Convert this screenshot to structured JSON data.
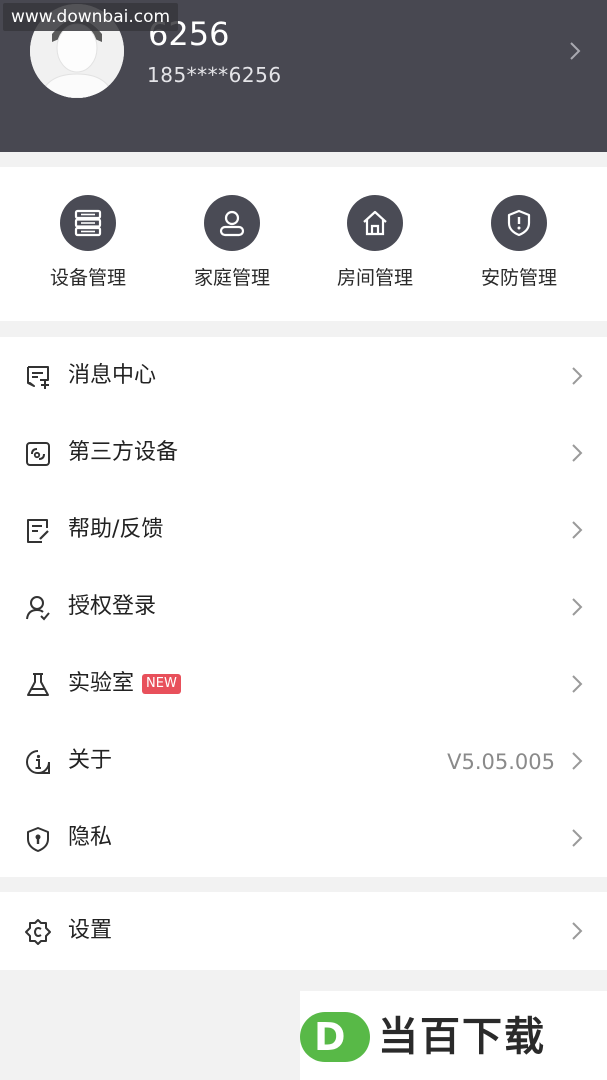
{
  "watermark_top": "www.downbai.com",
  "profile": {
    "name": "6256",
    "phone": "185****6256"
  },
  "quick_actions": [
    {
      "label": "设备管理",
      "icon": "device-list-icon"
    },
    {
      "label": "家庭管理",
      "icon": "user-icon"
    },
    {
      "label": "房间管理",
      "icon": "home-icon"
    },
    {
      "label": "安防管理",
      "icon": "shield-icon"
    }
  ],
  "menu": [
    {
      "label": "消息中心",
      "icon": "message-icon"
    },
    {
      "label": "第三方设备",
      "icon": "third-party-icon"
    },
    {
      "label": "帮助/反馈",
      "icon": "feedback-icon"
    },
    {
      "label": "授权登录",
      "icon": "auth-user-icon"
    },
    {
      "label": "实验室",
      "icon": "flask-icon",
      "badge": "NEW"
    },
    {
      "label": "关于",
      "icon": "info-icon",
      "value": "V5.05.005"
    },
    {
      "label": "隐私",
      "icon": "privacy-shield-icon"
    }
  ],
  "settings": {
    "label": "设置",
    "icon": "settings-icon"
  },
  "watermark_bottom": {
    "logo": "D",
    "text": "当百下载"
  },
  "colors": {
    "header_bg": "#484851",
    "icon_circle": "#4a4b55",
    "badge": "#e8505b",
    "logo_green": "#58b947"
  }
}
